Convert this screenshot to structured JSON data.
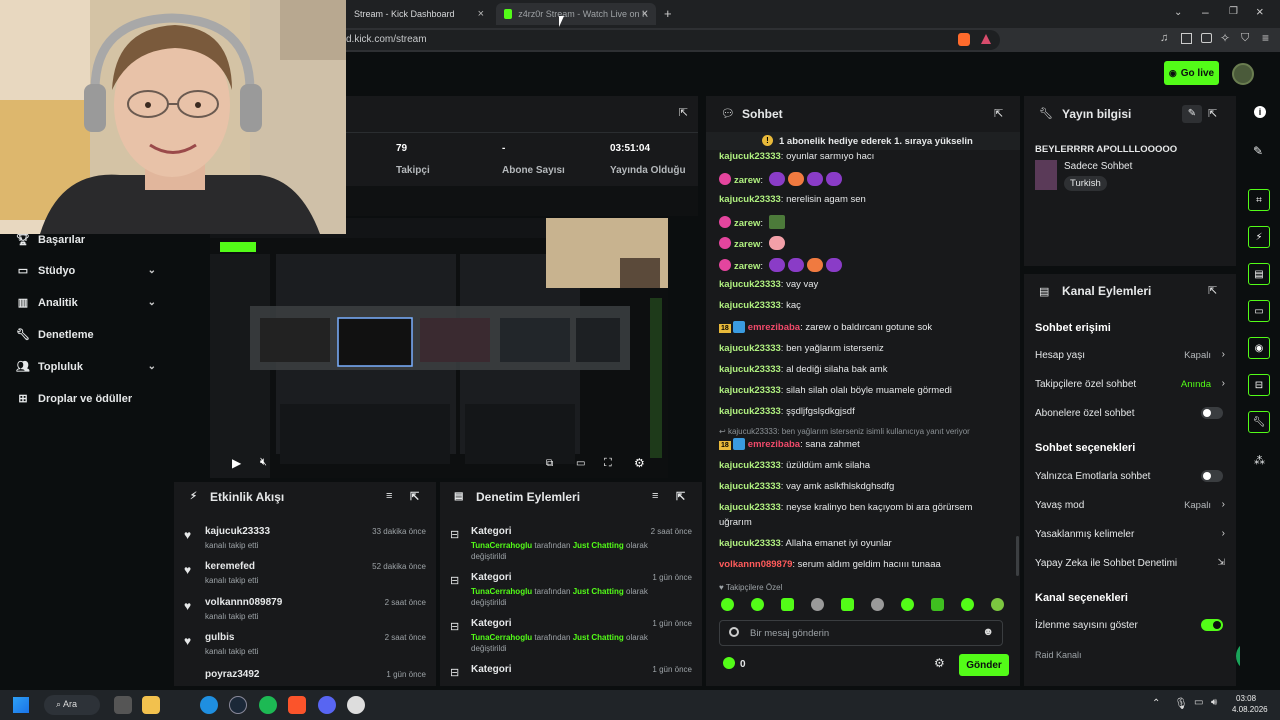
{
  "browser": {
    "tabs": [
      {
        "label": "Stream - Kick Dashboard"
      },
      {
        "label": "z4rz0r Stream - Watch Live on K"
      }
    ],
    "url": "d.kick.com/stream"
  },
  "header": {
    "go_live": "Go live"
  },
  "sidebar": {
    "items": [
      {
        "label": "Başarılar"
      },
      {
        "label": "Stüdyo"
      },
      {
        "label": "Analitik"
      },
      {
        "label": "Denetleme"
      },
      {
        "label": "Topluluk"
      },
      {
        "label": "Droplar ve ödüller"
      }
    ]
  },
  "stats": [
    {
      "value": "79",
      "label": "Takipçi"
    },
    {
      "value": "-",
      "label": "Abone Sayısı"
    },
    {
      "value": "03:51:04",
      "label": "Yayında Olduğu Süre"
    }
  ],
  "activity": {
    "title": "Etkinlik Akışı",
    "items": [
      {
        "user": "kajucuk23333",
        "text": "kanalı takip etti",
        "time": "33 dakika önce"
      },
      {
        "user": "keremefed",
        "text": "kanalı takip etti",
        "time": "52 dakika önce"
      },
      {
        "user": "volkannn089879",
        "text": "kanalı takip etti",
        "time": "2 saat önce"
      },
      {
        "user": "gulbis",
        "text": "kanalı takip etti",
        "time": "2 saat önce"
      },
      {
        "user": "poyraz3492",
        "text": "",
        "time": "1 gün önce"
      }
    ]
  },
  "moderation": {
    "title": "Denetim Eylemleri",
    "items": [
      {
        "type": "Kategori",
        "time": "2 saat önce",
        "user": "TunaCerrahoglu",
        "mid": "tarafından",
        "cat": "Just Chatting",
        "tail": "olarak",
        "end": "değiştirildi"
      },
      {
        "type": "Kategori",
        "time": "1 gün önce",
        "user": "TunaCerrahoglu",
        "mid": "tarafından",
        "cat": "Just Chatting",
        "tail": "olarak",
        "end": "değiştirildi"
      },
      {
        "type": "Kategori",
        "time": "1 gün önce",
        "user": "TunaCerrahoglu",
        "mid": "tarafından",
        "cat": "Just Chatting",
        "tail": "olarak",
        "end": "değiştirildi"
      },
      {
        "type": "Kategori",
        "time": "1 gün önce"
      }
    ]
  },
  "chat": {
    "title": "Sohbet",
    "pinned": "1 abonelik hediye ederek 1. sıraya yükselin",
    "messages": [
      {
        "user": "kajucuk23333",
        "text": ": oyunlar sarmıyo hacı"
      },
      {
        "user": "zarew",
        "text": ":"
      },
      {
        "user": "kajucuk23333",
        "text": ": nerelisin agam sen"
      },
      {
        "user": "zarew",
        "text": ":"
      },
      {
        "user": "zarew",
        "text": ":"
      },
      {
        "user": "zarew",
        "text": ":"
      },
      {
        "user": "kajucuk23333",
        "text": ": vay vay"
      },
      {
        "user": "kajucuk23333",
        "text": ": kaç"
      },
      {
        "user": "emrezibaba",
        "text": ": zarew o baldırcanı gotune sok"
      },
      {
        "user": "kajucuk23333",
        "text": ": ben yağlarım isterseniz"
      },
      {
        "user": "kajucuk23333",
        "text": ": al dediği silaha bak amk"
      },
      {
        "user": "kajucuk23333",
        "text": ": silah silah olalı böyle muamele görmedi"
      },
      {
        "user": "kajucuk23333",
        "text": ": şşdljfgslşdkgjsdf"
      },
      {
        "user": "emrezibaba",
        "text": ": sana zahmet"
      },
      {
        "user": "kajucuk23333",
        "text": ": üzüldüm amk silaha"
      },
      {
        "user": "kajucuk23333",
        "text": ": vay amk aslkfhlskdghsdfg"
      },
      {
        "user": "kajucuk23333",
        "text": ": neyse kralinyo ben kaçıyom bi ara görürsem"
      },
      {
        "user": "",
        "text": "uğrarım"
      },
      {
        "user": "kajucuk23333",
        "text": ": Allaha emanet iyi oyunlar"
      },
      {
        "user": "volkannn089879",
        "text": ": serum aldım geldim hacıııı tunaaa"
      }
    ],
    "reply_note": "kajucuk23333: ben yağlarım isterseniz isimli kullanıcıya yanıt veriyor",
    "badge_18": "18",
    "followers_only": "Takipçilere Özel",
    "placeholder": "Bir mesaj gönderin",
    "points": "0",
    "send": "Gönder"
  },
  "stream_info": {
    "title": "Yayın bilgisi",
    "stream_title": "BEYLERRRR APOLLLLOOOOO",
    "category": "Sadece Sohbet",
    "tag": "Turkish"
  },
  "channel_actions": {
    "title": "Kanal Eylemleri",
    "chat_access": "Sohbet erişimi",
    "account_age": "Hesap yaşı",
    "account_age_val": "Kapalı",
    "followers_chat": "Takipçilere özel sohbet",
    "followers_chat_val": "Anında",
    "subs_chat": "Abonelere özel sohbet",
    "chat_options": "Sohbet seçenekleri",
    "emote_only": "Yalnızca Emotlarla sohbet",
    "slow_mode": "Yavaş mod",
    "slow_mode_val": "Kapalı",
    "banned_words": "Yasaklanmış kelimeler",
    "ai_mod": "Yapay Zeka ile Sohbet Denetimi",
    "channel_options": "Kanal seçenekleri",
    "show_viewers": "İzlenme sayısını göster",
    "raid": "Raid Kanalı"
  },
  "taskbar": {
    "search": "Ara",
    "time": "03:08",
    "date": "4.08.2026"
  },
  "colors": {
    "accent": "#53fc18",
    "panel": "#18191b",
    "bg": "#0b0e0f"
  }
}
